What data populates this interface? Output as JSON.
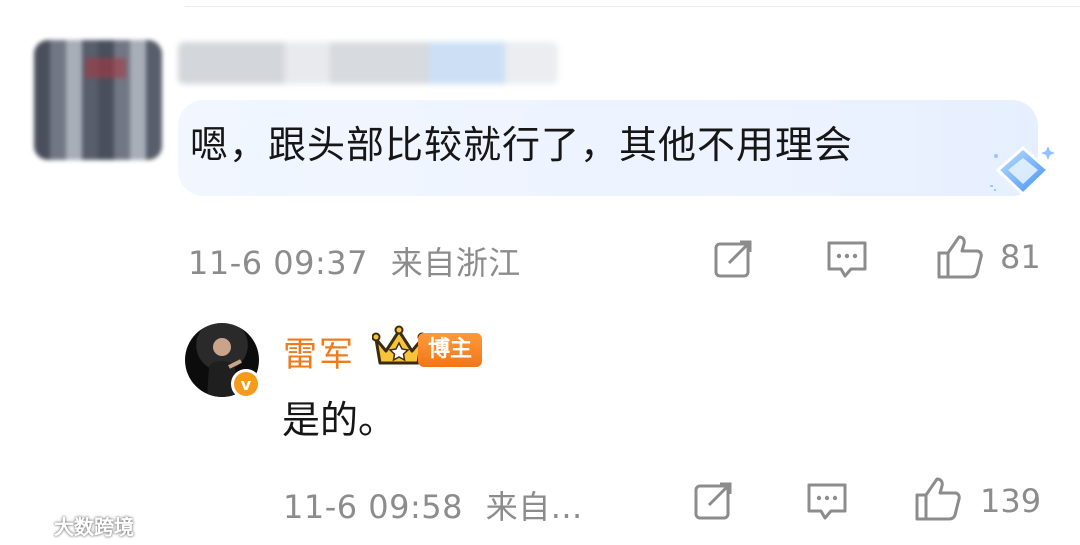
{
  "comment": {
    "text": "嗯，跟头部比较就行了，其他不用理会",
    "timestamp": "11-6 09:37",
    "location": "来自浙江",
    "like_count": "81"
  },
  "reply": {
    "author": "雷军",
    "author_tag": "博主",
    "verified_mark": "v",
    "text": "是的。",
    "timestamp": "11-6 09:58",
    "location": "来自...",
    "like_count": "139"
  },
  "watermark": {
    "text": "大数跨境"
  },
  "colors": {
    "author_orange": "#f27a1b",
    "meta_gray": "#8c8c8c",
    "bubble_blue": "#eef4ff"
  },
  "icons": [
    "share-icon",
    "comment-icon",
    "like-icon",
    "diamond-badge-icon",
    "crown-icon"
  ]
}
